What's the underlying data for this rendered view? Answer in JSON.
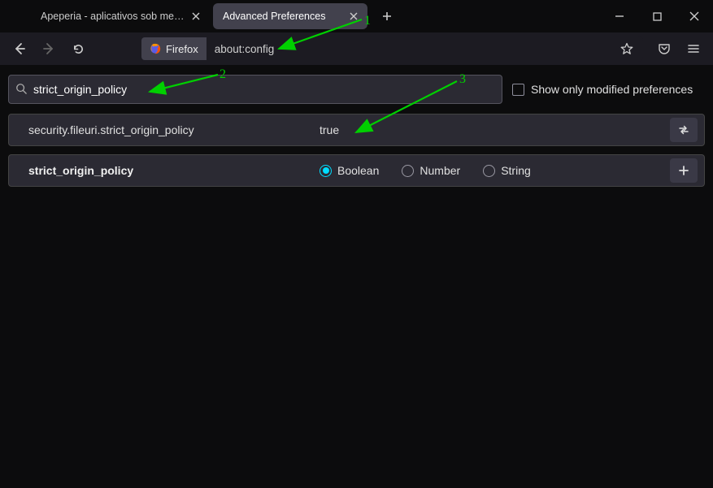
{
  "tabs": [
    {
      "title": "Apeperia - aplicativos sob medida"
    },
    {
      "title": "Advanced Preferences"
    }
  ],
  "identity_label": "Firefox",
  "url": "about:config",
  "search_value": "strict_origin_policy",
  "show_modified_label": "Show only modified preferences",
  "pref": {
    "name": "security.fileuri.strict_origin_policy",
    "value": "true"
  },
  "new_pref": {
    "name": "strict_origin_policy",
    "type_options": [
      "Boolean",
      "Number",
      "String"
    ],
    "selected": 0
  },
  "annotations": {
    "a1": "1",
    "a2": "2",
    "a3": "3"
  }
}
